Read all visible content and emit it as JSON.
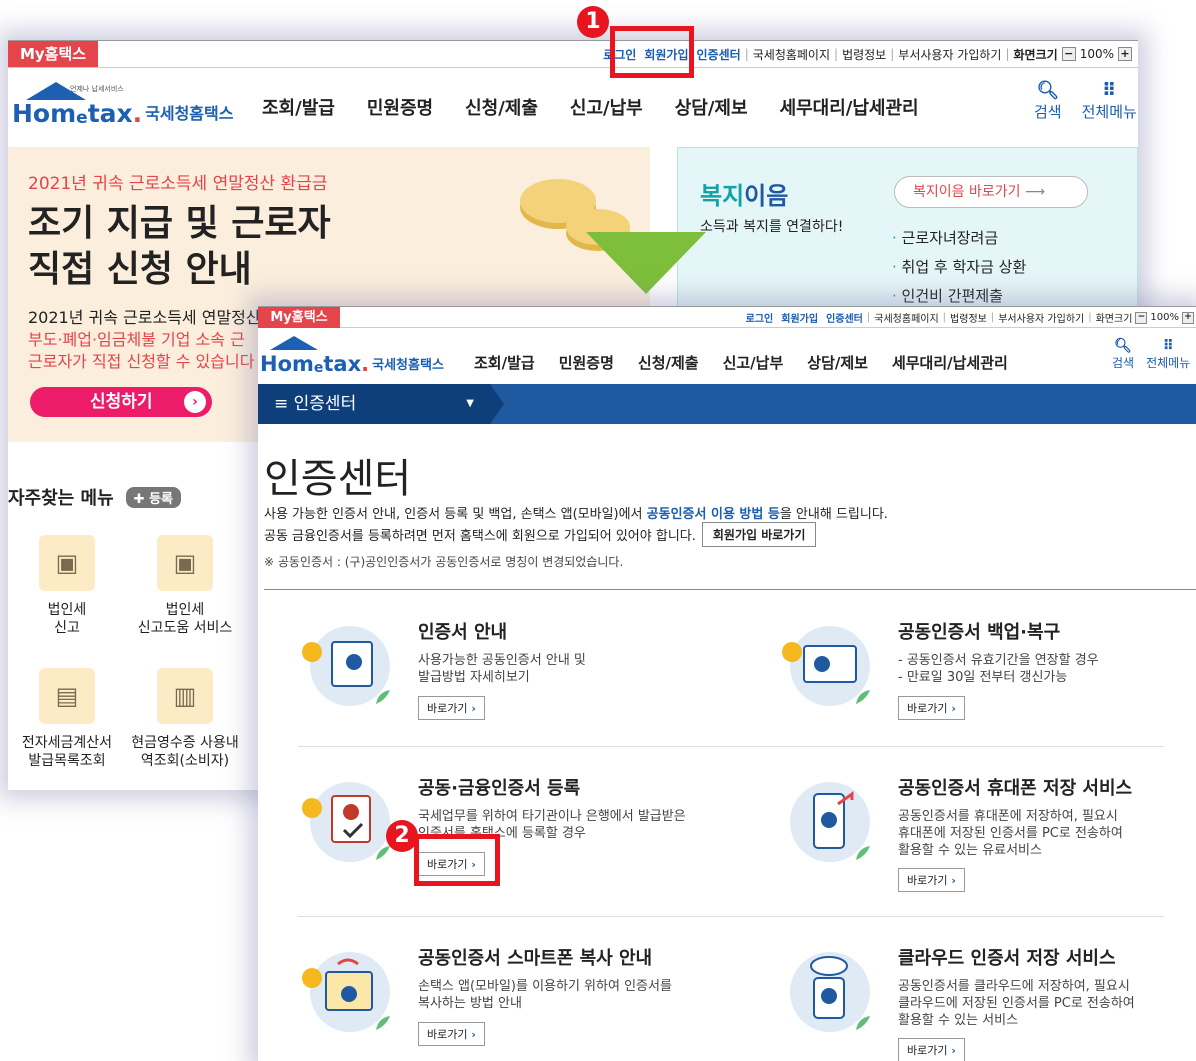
{
  "back": {
    "my_tab": "My홈택스",
    "util": {
      "login": "로그인",
      "join": "회원가입",
      "cert": "인증센터",
      "nts": "국세청홈페이지",
      "law": "법령정보",
      "dept": "부서사용자 가입하기",
      "screen": "화면크기",
      "zoom": "100%"
    },
    "logo": {
      "small": "언제나 납세서비스",
      "home": "Hom",
      "e": "e",
      "tax": "tax",
      "dot": ".",
      "kor": "국세청홈택스"
    },
    "nav": [
      "조회/발급",
      "민원증명",
      "신청/제출",
      "신고/납부",
      "상담/제보",
      "세무대리/납세관리"
    ],
    "search": "검색",
    "allmenu": "전체메뉴",
    "banner": {
      "sub": "2021년 귀속 근로소득세 연말정산 환급금",
      "title1": "조기 지급 및 근로자",
      "title2": "직접 신청 안내",
      "line1": "2021년 귀속 근로소득세 연말정산",
      "line2": "부도·폐업·임금체불 기업 소속 근",
      "line3": "근로자가 직접 신청할 수 있습니다",
      "btn": "신청하기"
    },
    "welfare": {
      "title_a": "복지",
      "title_b": "이음",
      "sub": "소득과 복지를 연결하다!",
      "link": "복지이음 바로가기",
      "items": [
        "근로자녀장려금",
        "취업 후 학자금 상환",
        "인건비 간편제출"
      ]
    },
    "fav": {
      "title": "자주찾는 메뉴",
      "add": "등록",
      "items": [
        {
          "l1": "법인세",
          "l2": "신고"
        },
        {
          "l1": "법인세",
          "l2": "신고도움 서비스"
        },
        {
          "l1": "전자세금계산서",
          "l2": "발급목록조회"
        },
        {
          "l1": "현금영수증 사용내",
          "l2": "역조회(소비자)"
        }
      ]
    }
  },
  "front": {
    "crumb": "인증센터",
    "title": "인증센터",
    "intro1a": "사용 가능한 인증서 안내, 인증서 등록 및 백업, 손택스 앱(모바일)에서 ",
    "intro1b": "공동인증서 이용 방법 등",
    "intro1c": "을 안내해 드립니다.",
    "intro2": "공동 금융인증서를 등록하려면 먼저 홈택스에 회원으로 가입되어 있어야 합니다.",
    "join_btn": "회원가입 바로가기",
    "note": "※ 공동인증서 : (구)공인인증서가 공동인증서로 명칭이 변경되었습니다.",
    "go": "바로가기",
    "cards": [
      {
        "title": "인증서 안내",
        "desc": [
          "사용가능한 공동인증서 안내 및",
          "발급방법 자세히보기"
        ]
      },
      {
        "title": "공동인증서 백업·복구",
        "desc": [
          "- 공동인증서 유효기간을 연장할 경우",
          "- 만료일 30일 전부터 갱신가능"
        ]
      },
      {
        "title": "공동·금융인증서 등록",
        "desc": [
          "국세업무를 위하여 타기관이나 은행에서 발급받은",
          "인증서를 홈택스에 등록할 경우"
        ]
      },
      {
        "title": "공동인증서 휴대폰 저장 서비스",
        "desc": [
          "공동인증서를 휴대폰에 저장하여, 필요시",
          "휴대폰에 저장된 인증서를 PC로 전송하여",
          "활용할 수 있는 유료서비스"
        ]
      },
      {
        "title": "공동인증서 스마트폰 복사 안내",
        "desc": [
          "손택스 앱(모바일)를 이용하기 위하여 인증서를",
          "복사하는 방법 안내"
        ]
      },
      {
        "title": "클라우드 인증서 저장 서비스",
        "desc": [
          "공동인증서를 클라우드에 저장하여, 필요시",
          "클라우드에 저장된 인증서를 PC로 전송하여",
          "활용할 수 있는 서비스"
        ]
      }
    ]
  },
  "markers": {
    "one": "1",
    "two": "2"
  }
}
